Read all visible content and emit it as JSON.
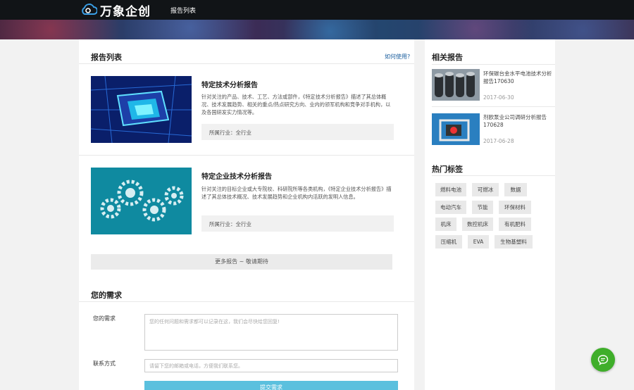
{
  "header": {
    "logo_text": "万象企创",
    "nav": [
      "报告列表"
    ]
  },
  "report_list": {
    "title": "报告列表",
    "help_link": "如何使用?",
    "items": [
      {
        "title": "特定技术分析报告",
        "desc": "针对关注的产品、技术、工艺、方法或部件，《特定技术分析报告》描述了其总体概况、技术发展趋势、相关的重点/热点研究方向、业内的领军机构和竞争对手机构，以及各国研发实力情况等。",
        "industry": "所属行业：全行业"
      },
      {
        "title": "特定企业技术分析报告",
        "desc": "针对关注的目标企业或大专院校、科研院所等各类机构，《特定企业技术分析报告》描述了其总体技术概况、技术发展趋势和企业机构内活跃的发明人信息。",
        "industry": "所属行业：全行业"
      }
    ],
    "more_button": "更多报告 ~ 敬请期待"
  },
  "demand": {
    "title": "您的需求",
    "label_demand": "您的需求",
    "demand_placeholder": "您的任何问题和需求都可以记录在这，我们会尽快给您回复!",
    "label_contact": "联系方式",
    "contact_placeholder": "请留下您的邮箱或电话，方便我们联系您。",
    "submit": "提交需求"
  },
  "related": {
    "title": "相关报告",
    "items": [
      {
        "title": "环保碳台金水平电池技术分析报告170630",
        "date": "2017-06-30"
      },
      {
        "title": "剂欧泵业公司调研分析报告170628",
        "date": "2017-06-28"
      }
    ]
  },
  "hot_tags": {
    "title": "热门标签",
    "tags": [
      "燃料电池",
      "可燃冰",
      "数据",
      "电动汽车",
      "节能",
      "环保材料",
      "机床",
      "数控机床",
      "有机肥料",
      "压缩机",
      "EVA",
      "生物基塑料"
    ]
  },
  "colors": {
    "link": "#1a5e9e",
    "submit": "#5bc0de",
    "chat": "#3fae2a"
  },
  "icons": {
    "logo": "cloud-logo-icon",
    "chat": "chat-bubble-icon"
  }
}
